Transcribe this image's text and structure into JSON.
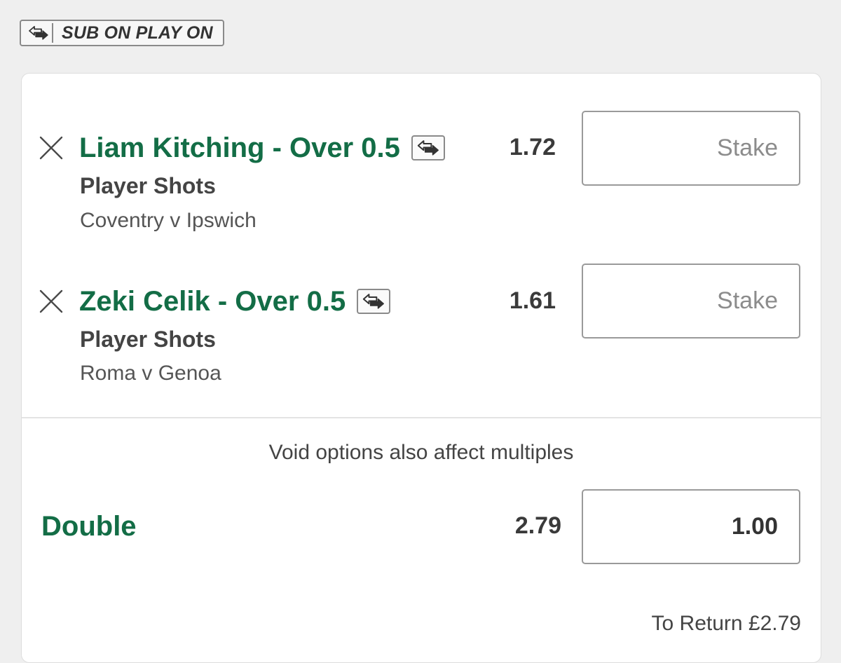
{
  "badge": {
    "label": "SUB ON PLAY ON",
    "icon": "sub-on-play-on-icon"
  },
  "selections": [
    {
      "title": "Liam Kitching - Over 0.5",
      "market": "Player Shots",
      "event": "Coventry v Ipswich",
      "odds": "1.72",
      "stake_placeholder": "Stake",
      "stake_value": ""
    },
    {
      "title": "Zeki Celik - Over 0.5",
      "market": "Player Shots",
      "event": "Roma v Genoa",
      "odds": "1.61",
      "stake_placeholder": "Stake",
      "stake_value": ""
    }
  ],
  "void_note": "Void options also affect multiples",
  "multiple": {
    "label": "Double",
    "odds": "2.79",
    "stake_value": "1.00"
  },
  "to_return": "To Return £2.79",
  "colors": {
    "accent_green": "#136d46",
    "background": "#efefef"
  }
}
